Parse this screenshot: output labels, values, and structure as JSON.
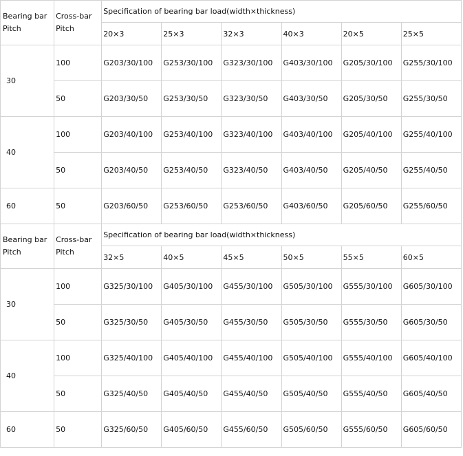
{
  "tables": [
    {
      "header": {
        "bearing_bar_pitch": [
          "Bearing bar",
          "Pitch"
        ],
        "cross_bar_pitch": [
          "Cross-bar",
          "Pitch"
        ],
        "spec_title": "Specification of bearing bar load(width×thickness)",
        "sizes": [
          "20×3",
          "25×3",
          "32×3",
          "40×3",
          "20×5",
          "25×5"
        ]
      },
      "rows": [
        {
          "pitch": "30",
          "cross": "100",
          "cells": [
            "G203/30/100",
            "G253/30/100",
            "G323/30/100",
            "G403/30/100",
            "G205/30/100",
            "G255/30/100"
          ]
        },
        {
          "pitch": "",
          "cross": "50",
          "cells": [
            "G203/30/50",
            "G253/30/50",
            "G323/30/50",
            "G403/30/50",
            "G205/30/50",
            "G255/30/50"
          ]
        },
        {
          "pitch": "40",
          "cross": "100",
          "cells": [
            "G203/40/100",
            "G253/40/100",
            "G323/40/100",
            "G403/40/100",
            "G205/40/100",
            "G255/40/100"
          ]
        },
        {
          "pitch": "",
          "cross": "50",
          "cells": [
            "G203/40/50",
            "G253/40/50",
            "G323/40/50",
            "G403/40/50",
            "G205/40/50",
            "G255/40/50"
          ]
        },
        {
          "pitch": "60",
          "cross": "50",
          "cells": [
            "G203/60/50",
            "G253/60/50",
            "G253/60/50",
            "G403/60/50",
            "G205/60/50",
            "G255/60/50"
          ]
        }
      ]
    },
    {
      "header": {
        "bearing_bar_pitch": [
          "Bearing bar",
          "Pitch"
        ],
        "cross_bar_pitch": [
          "Cross-bar",
          "Pitch"
        ],
        "spec_title": "Specification of bearing bar load(width×thickness)",
        "sizes": [
          "32×5",
          "40×5",
          "45×5",
          "50×5",
          "55×5",
          "60×5"
        ]
      },
      "rows": [
        {
          "pitch": "30",
          "cross": "100",
          "cells": [
            "G325/30/100",
            "G405/30/100",
            "G455/30/100",
            "G505/30/100",
            "G555/30/100",
            "G605/30/100"
          ]
        },
        {
          "pitch": "",
          "cross": "50",
          "cells": [
            "G325/30/50",
            "G405/30/50",
            "G455/30/50",
            "G505/30/50",
            "G555/30/50",
            "G605/30/50"
          ]
        },
        {
          "pitch": "40",
          "cross": "100",
          "cells": [
            "G325/40/100",
            "G405/40/100",
            "G455/40/100",
            "G505/40/100",
            "G555/40/100",
            "G605/40/100"
          ]
        },
        {
          "pitch": "",
          "cross": "50",
          "cells": [
            "G325/40/50",
            "G405/40/50",
            "G455/40/50",
            "G505/40/50",
            "G555/40/50",
            "G605/40/50"
          ]
        },
        {
          "pitch": "60",
          "cross": "50",
          "cells": [
            "G325/60/50",
            "G405/60/50",
            "G455/60/50",
            "G505/60/50",
            "G555/60/50",
            "G605/60/50"
          ]
        }
      ]
    }
  ]
}
